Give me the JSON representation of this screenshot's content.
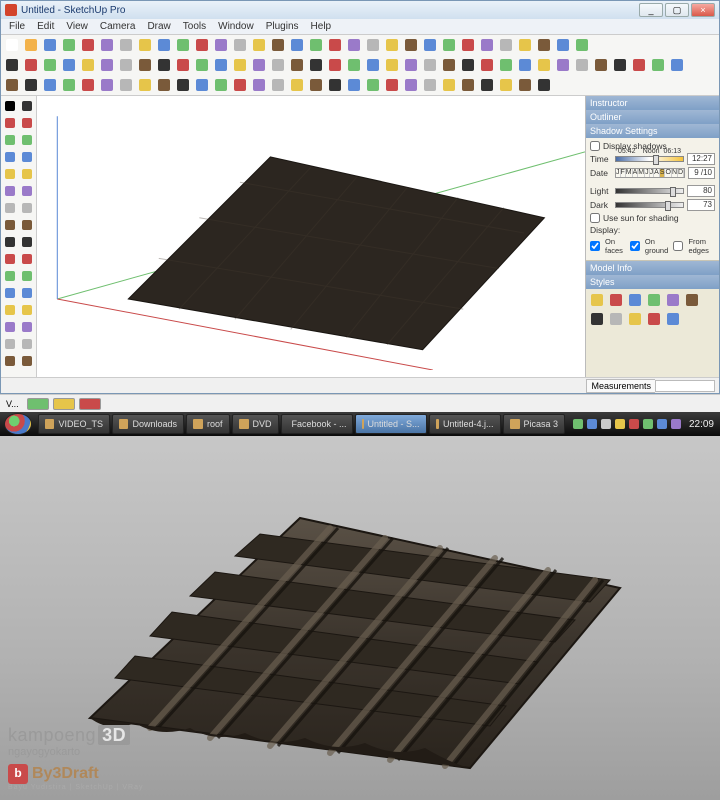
{
  "window": {
    "title": "Untitled - SketchUp Pro",
    "controls": {
      "min": "_",
      "max": "▢",
      "close": "×"
    }
  },
  "menu": [
    "File",
    "Edit",
    "View",
    "Camera",
    "Draw",
    "Tools",
    "Window",
    "Plugins",
    "Help"
  ],
  "toolbar_colors_row1": [
    "#fff",
    "#f3b24a",
    "#5c8ad6",
    "#6fbf6f",
    "#c94a4a",
    "#9a7ac9",
    "#b7b7b7",
    "#e6c54a",
    "#5c8ad6",
    "#6fbf6f",
    "#c94a4a",
    "#9a7ac9",
    "#b7b7b7",
    "#e6c54a",
    "#7a5a3a",
    "#5c8ad6",
    "#6fbf6f",
    "#c94a4a",
    "#9a7ac9",
    "#b7b7b7",
    "#e6c54a",
    "#7a5a3a",
    "#5c8ad6",
    "#6fbf6f",
    "#c94a4a",
    "#9a7ac9",
    "#b7b7b7",
    "#e6c54a",
    "#7a5a3a",
    "#5c8ad6",
    "#6fbf6f"
  ],
  "toolbar_colors_row2": [
    "#333",
    "#c94a4a",
    "#6fbf6f",
    "#5c8ad6",
    "#e6c54a",
    "#9a7ac9",
    "#b7b7b7",
    "#7a5a3a",
    "#333",
    "#c94a4a",
    "#6fbf6f",
    "#5c8ad6",
    "#e6c54a",
    "#9a7ac9",
    "#b7b7b7",
    "#7a5a3a",
    "#333",
    "#c94a4a",
    "#6fbf6f",
    "#5c8ad6",
    "#e6c54a",
    "#9a7ac9",
    "#b7b7b7",
    "#7a5a3a",
    "#333",
    "#c94a4a",
    "#6fbf6f",
    "#5c8ad6",
    "#e6c54a",
    "#9a7ac9",
    "#b7b7b7",
    "#7a5a3a",
    "#333",
    "#c94a4a",
    "#6fbf6f",
    "#5c8ad6"
  ],
  "toolbar_colors_row3": [
    "#7a5a3a",
    "#333",
    "#5c8ad6",
    "#6fbf6f",
    "#c94a4a",
    "#9a7ac9",
    "#b7b7b7",
    "#e6c54a",
    "#7a5a3a",
    "#333",
    "#5c8ad6",
    "#6fbf6f",
    "#c94a4a",
    "#9a7ac9",
    "#b7b7b7",
    "#e6c54a",
    "#7a5a3a",
    "#333",
    "#5c8ad6",
    "#6fbf6f",
    "#c94a4a",
    "#9a7ac9",
    "#b7b7b7",
    "#e6c54a",
    "#7a5a3a",
    "#333",
    "#e6c54a",
    "#7a5a3a",
    "#333"
  ],
  "tray_extra_colors": [
    "#e6c54a",
    "#c94a4a",
    "#5c8ad6",
    "#6fbf6f",
    "#9a7ac9",
    "#7a5a3a",
    "#333",
    "#b7b7b7",
    "#e6c54a",
    "#c94a4a",
    "#5c8ad6"
  ],
  "palette_colors": [
    "#000",
    "#c94a4a",
    "#6fbf6f",
    "#5c8ad6",
    "#e6c54a",
    "#9a7ac9",
    "#b7b7b7",
    "#7a5a3a",
    "#333",
    "#c94a4a",
    "#6fbf6f",
    "#5c8ad6",
    "#e6c54a",
    "#9a7ac9",
    "#b7b7b7",
    "#7a5a3a",
    "#333",
    "#c94a4a",
    "#6fbf6f",
    "#5c8ad6",
    "#e6c54a",
    "#9a7ac9",
    "#b7b7b7",
    "#7a5a3a",
    "#333",
    "#c94a4a",
    "#6fbf6f",
    "#5c8ad6",
    "#e6c54a",
    "#9a7ac9",
    "#b7b7b7",
    "#7a5a3a"
  ],
  "tray": {
    "headers": [
      "Instructor",
      "Outliner",
      "Shadow Settings",
      "Model Info",
      "Styles"
    ],
    "display_shadows": "Display shadows",
    "time_label": "Time",
    "time_left": "05:42",
    "time_mid": "Noon",
    "time_right": "06:13",
    "time_value": "12:27",
    "date_label": "Date",
    "months": [
      "J",
      "F",
      "M",
      "A",
      "M",
      "J",
      "J",
      "A",
      "S",
      "O",
      "N",
      "D"
    ],
    "date_value": "9 /10",
    "light_label": "Light",
    "light_value": "80",
    "dark_label": "Dark",
    "dark_value": "73",
    "use_sun": "Use sun for shading",
    "display_label": "Display:",
    "on_faces": "On faces",
    "on_ground": "On ground",
    "from_edges": "From edges"
  },
  "status": {
    "measurements_label": "Measurements"
  },
  "status_v": {
    "label": "V..."
  },
  "taskbar": {
    "items": [
      "VIDEO_TS",
      "Downloads",
      "roof",
      "DVD",
      "Facebook - ...",
      "Untitled - S...",
      "Untitled-4.j...",
      "Picasa 3"
    ],
    "active_index": 5,
    "tray_colors": [
      "#6fbf6f",
      "#5c8ad6",
      "#c9c9c9",
      "#e6c54a",
      "#c94a4a",
      "#6fbf6f",
      "#5c8ad6",
      "#9a7ac9"
    ],
    "clock": "22:09"
  },
  "watermark": {
    "brand1a": "kampoeng",
    "brand1b": "3D",
    "brand2": "ngayogyokarto",
    "brand3_letter": "b",
    "brand3_label": "By3Draft",
    "subline": "Bayu Yudistira | SketchUp | VRay"
  }
}
